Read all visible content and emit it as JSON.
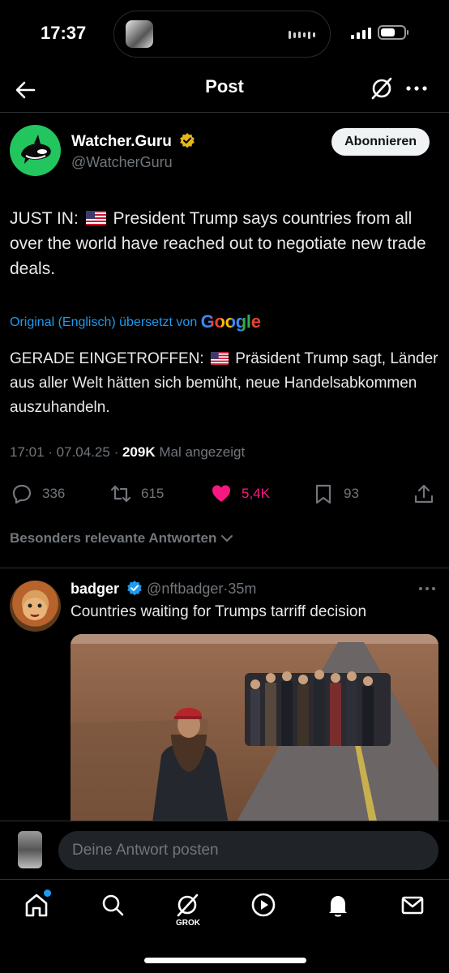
{
  "status_bar": {
    "time": "17:37"
  },
  "header": {
    "title": "Post"
  },
  "post": {
    "author_name": "Watcher.Guru",
    "author_handle": "@WatcherGuru",
    "follow_label": "Abonnieren",
    "text_prefix": "JUST IN:",
    "text_body": "President Trump says countries from all over the world have reached out to negotiate new trade deals.",
    "translation_label": "Original (Englisch) übersetzt von",
    "translation_provider": "Google",
    "translated_prefix": "GERADE EINGETROFFEN:",
    "translated_body": "Präsident Trump sagt, Länder aus aller Welt hätten sich bemüht, neue Handelsabkommen auszuhandeln.",
    "time": "17:01",
    "date": "07.04.25",
    "views": "209K",
    "views_label": "Mal angezeigt",
    "replies": "336",
    "reposts": "615",
    "likes": "5,4K",
    "bookmarks": "93"
  },
  "relevant_label": "Besonders relevante Antworten",
  "reply": {
    "name": "badger",
    "handle": "@nftbadger",
    "age": "35m",
    "text": "Countries waiting for Trumps tarriff decision"
  },
  "composer": {
    "placeholder": "Deine Antwort posten"
  },
  "tabbar": {
    "grok_label": "GROK"
  },
  "colors": {
    "accent": "#1d9bf0",
    "like": "#f91880",
    "background": "#000000",
    "muted": "#71767b"
  }
}
